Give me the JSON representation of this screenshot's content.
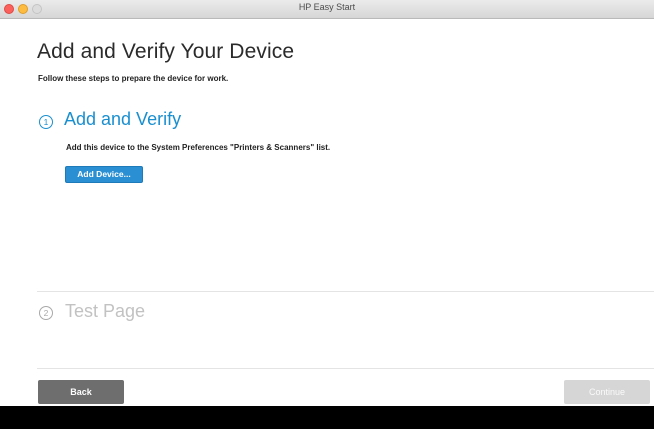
{
  "window": {
    "title": "HP Easy Start"
  },
  "header": {
    "title": "Add and Verify Your Device",
    "subtitle": "Follow these steps to prepare the device for work."
  },
  "steps": [
    {
      "number": "1",
      "title": "Add and Verify",
      "description": "Add this device to the System Preferences \"Printers & Scanners\" list.",
      "button_label": "Add Device...",
      "state": "active"
    },
    {
      "number": "2",
      "title": "Test Page",
      "state": "inactive"
    }
  ],
  "footer": {
    "back_label": "Back",
    "continue_label": "Continue"
  },
  "colors": {
    "accent": "#1a8fd0",
    "button_primary": "#2a8fd3",
    "back_button": "#6e6e6e",
    "disabled": "#d6d6d6"
  }
}
